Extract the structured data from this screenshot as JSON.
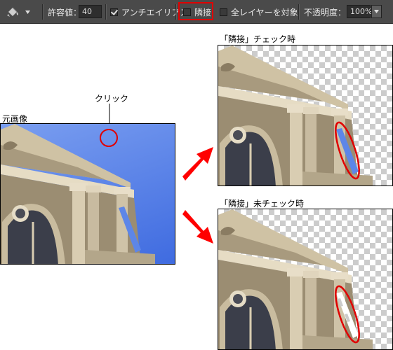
{
  "toolbar": {
    "tool_icon": "paint-bucket-icon",
    "tolerance_label": "許容値：",
    "tolerance_value": "40",
    "antialias_label": "アンチエイリアス",
    "antialias_checked": true,
    "contiguous_label": "隣接",
    "contiguous_checked": false,
    "all_layers_label": "全レイヤーを対象",
    "all_layers_checked": false,
    "opacity_label": "不透明度：",
    "opacity_value": "100%"
  },
  "original": {
    "label": "元画像",
    "click_label": "クリック"
  },
  "results": {
    "checked_label": "「隣接」チェック時",
    "unchecked_label": "「隣接」未チェック時"
  },
  "colors": {
    "highlight": "#e00000",
    "arrow": "#ff0000",
    "sky": "#5a82e8"
  }
}
